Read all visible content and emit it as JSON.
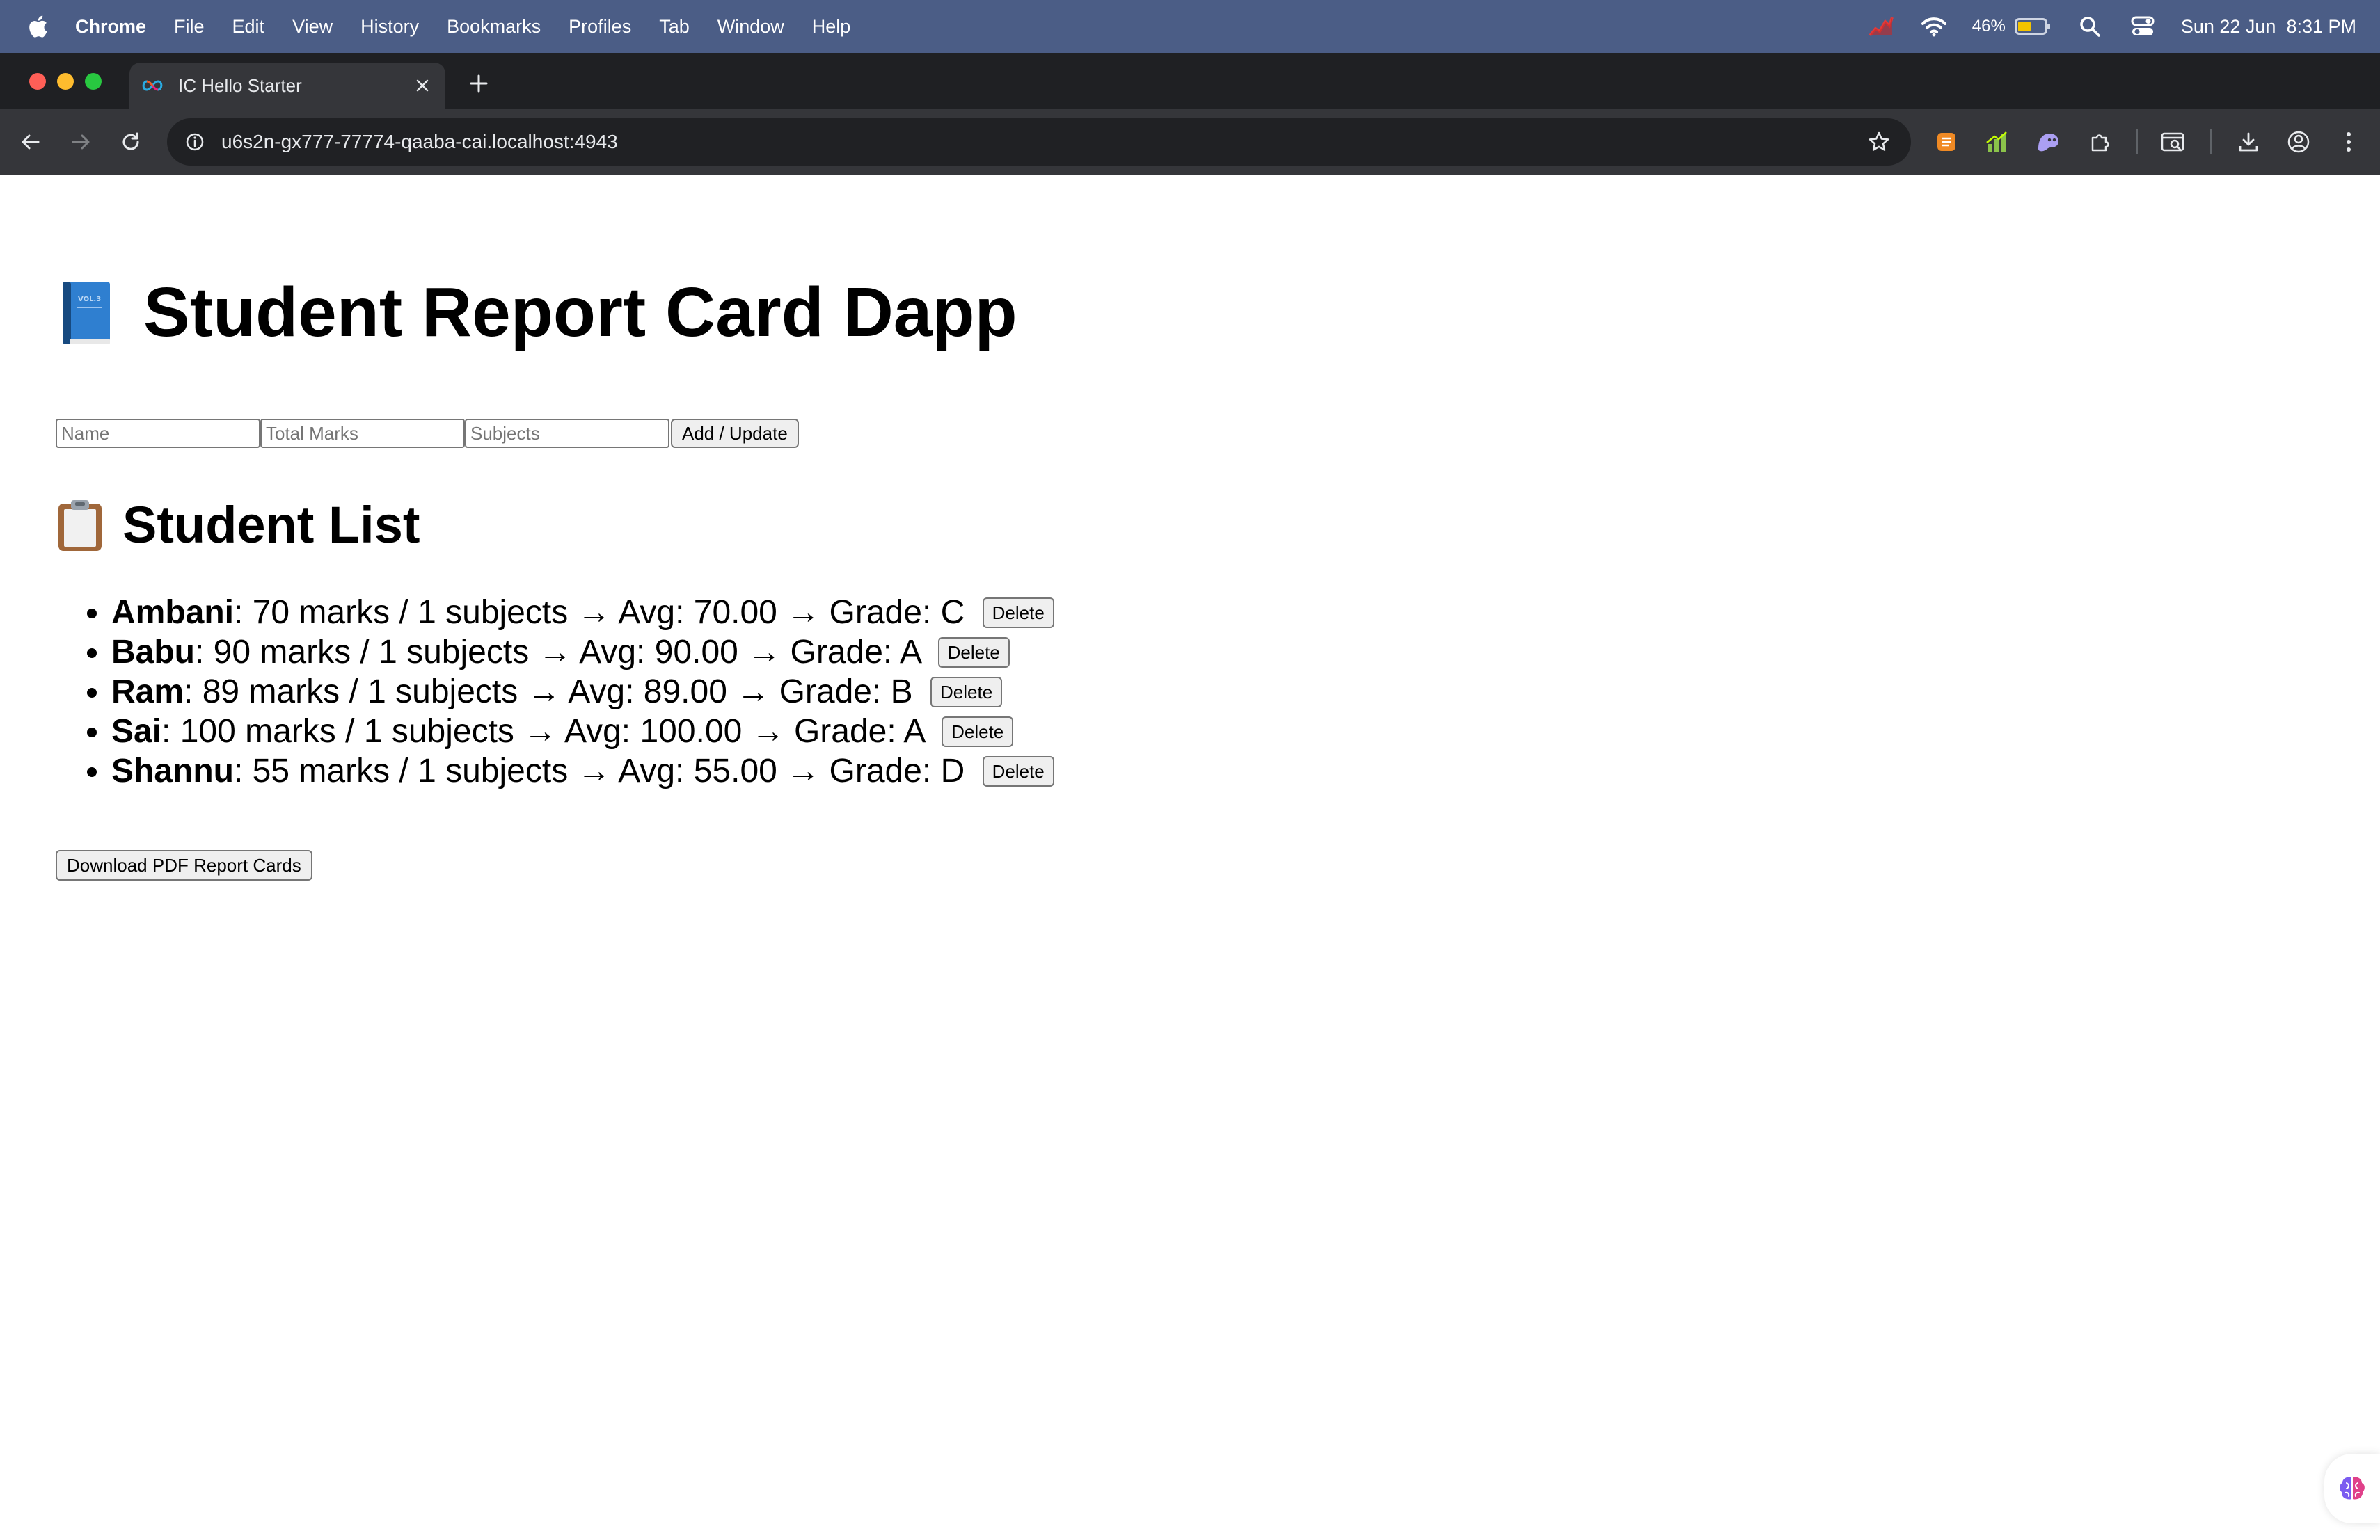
{
  "menubar": {
    "app_name": "Chrome",
    "items": [
      "File",
      "Edit",
      "View",
      "History",
      "Bookmarks",
      "Profiles",
      "Tab",
      "Window",
      "Help"
    ],
    "battery_percent": "46%",
    "datetime": "Sun 22 Jun  8:31 PM"
  },
  "browser": {
    "tab_title": "IC Hello Starter",
    "url": "u6s2n-gx777-77774-qaaba-cai.localhost:4943"
  },
  "page": {
    "title": "Student Report Card Dapp",
    "title_icon": "blue-book-icon",
    "form": {
      "name_placeholder": "Name",
      "marks_placeholder": "Total Marks",
      "subjects_placeholder": "Subjects",
      "submit_label": "Add / Update"
    },
    "list_heading": "Student List",
    "list_icon": "clipboard-icon",
    "students": [
      {
        "name": "Ambani",
        "details": ": 70 marks / 1 subjects → Avg: 70.00 → Grade: C",
        "delete_label": "Delete"
      },
      {
        "name": "Babu",
        "details": ": 90 marks / 1 subjects → Avg: 90.00 → Grade: A",
        "delete_label": "Delete"
      },
      {
        "name": "Ram",
        "details": ": 89 marks / 1 subjects → Avg: 89.00 → Grade: B",
        "delete_label": "Delete"
      },
      {
        "name": "Sai",
        "details": ": 100 marks / 1 subjects → Avg: 100.00 → Grade: A",
        "delete_label": "Delete"
      },
      {
        "name": "Shannu",
        "details": ": 55 marks / 1 subjects → Avg: 55.00 → Grade: D",
        "delete_label": "Delete"
      }
    ],
    "download_label": "Download PDF Report Cards"
  }
}
